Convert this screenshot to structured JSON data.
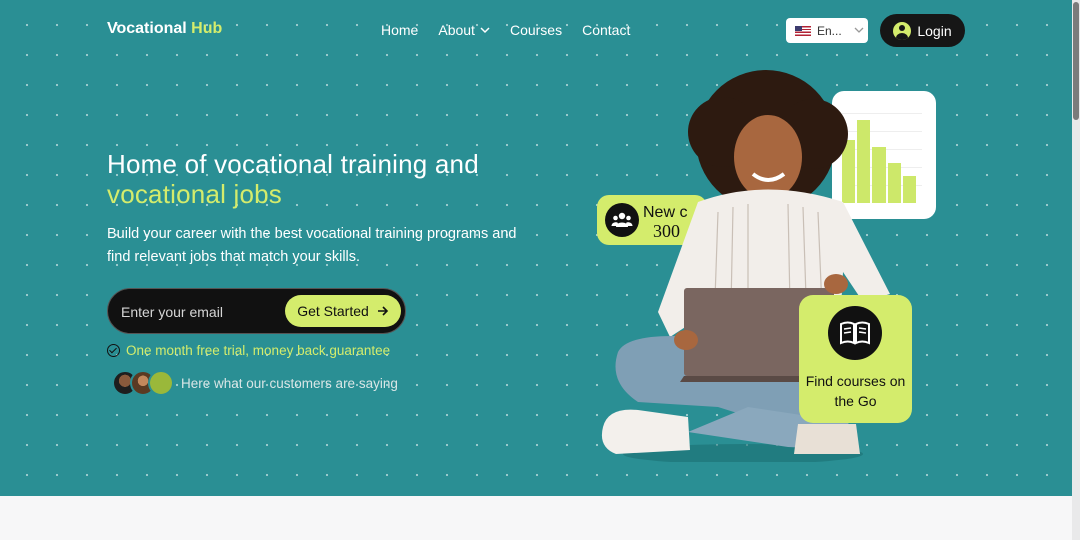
{
  "brand": {
    "name_part1": "Vocational",
    "name_part2": "Hub"
  },
  "nav": {
    "items": [
      {
        "label": "Home"
      },
      {
        "label": "About"
      },
      {
        "label": "Courses"
      },
      {
        "label": "Contact"
      }
    ]
  },
  "language": {
    "selected": "En..."
  },
  "login": {
    "label": "Login"
  },
  "hero": {
    "title_line1": "Home of vocational training and",
    "title_highlight": "vocational jobs",
    "subtitle": "Build your career with the best vocational training programs and find relevant jobs that match your skills.",
    "email_placeholder": "Enter your email",
    "cta_label": "Get Started",
    "guarantee": "One month free trial, money back guarantee",
    "customers_text": "Here what our customers are saying"
  },
  "cards": {
    "stat": {
      "line1": "New c",
      "line2": "300"
    },
    "find": {
      "label": "Find courses on the Go"
    }
  },
  "colors": {
    "primary": "#2a8f94",
    "accent": "#d4ec6c",
    "dark": "#111111"
  }
}
